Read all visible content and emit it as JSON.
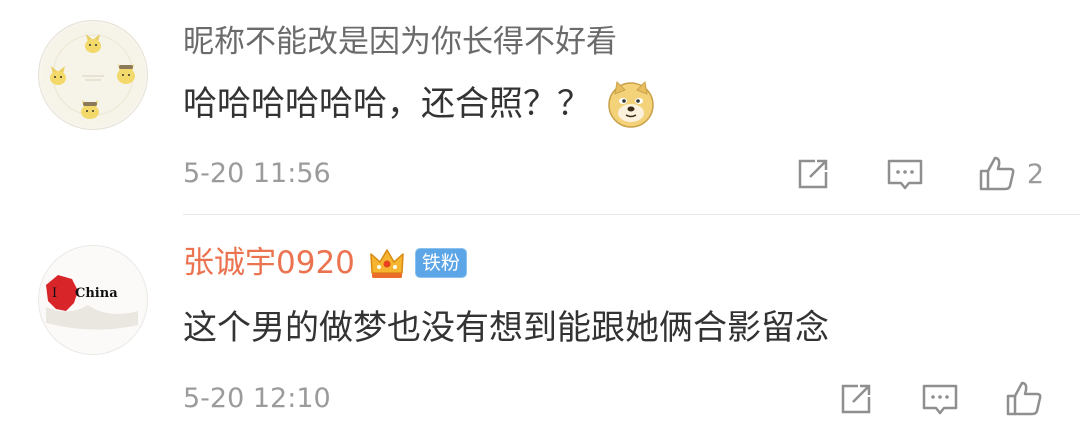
{
  "comments": [
    {
      "username": "昵称不能改是因为你长得不好看",
      "text": "哈哈哈哈哈哈，还合照？？",
      "time": "5-20 11:56",
      "likes": "2",
      "emoji": "doge-emoji"
    },
    {
      "username": "张诚宇0920",
      "badge": "铁粉",
      "text": "这个男的做梦也没有想到能跟她俩合影留念",
      "time": "5-20 12:10",
      "avatar_text": "I ♥ China"
    }
  ],
  "colors": {
    "username_gray": "#6b6b6b",
    "username_vip": "#eb7350",
    "body": "#333333",
    "meta": "#9b9b9b",
    "badge": "#5ca6e8",
    "divider": "#e6e6e6"
  },
  "icons": [
    "share-icon",
    "comment-icon",
    "like-icon",
    "crown-icon",
    "doge-emoji"
  ]
}
